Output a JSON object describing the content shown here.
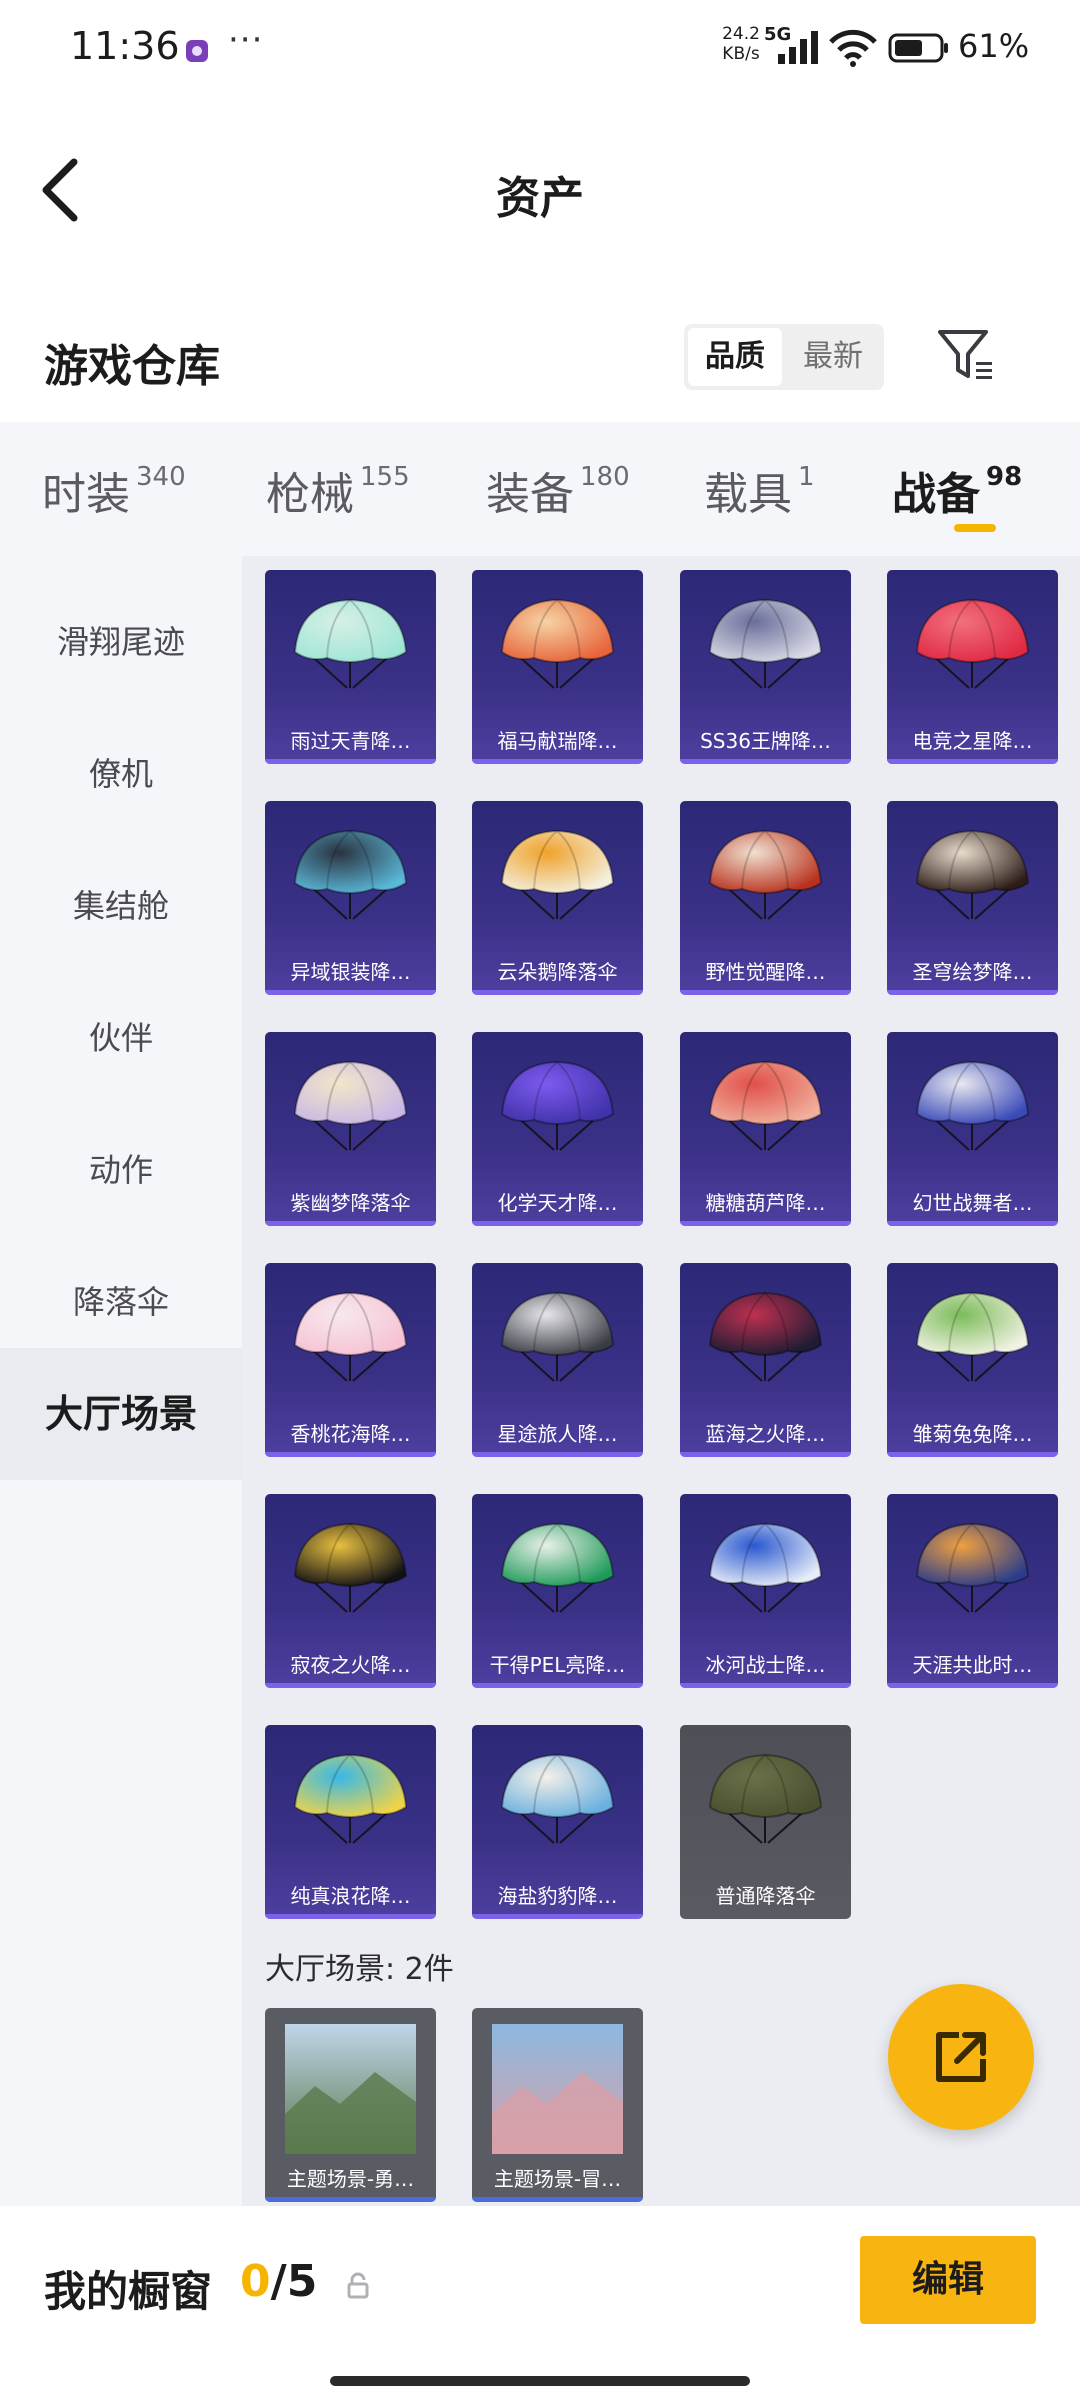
{
  "status_bar": {
    "time": "11:36",
    "network_speed_value": "24.2",
    "network_speed_unit": "KB/s",
    "network_type": "5G",
    "battery": "61%",
    "more": "···"
  },
  "header": {
    "title": "资产"
  },
  "section": {
    "title": "游戏仓库",
    "sort_options": [
      "品质",
      "最新"
    ]
  },
  "tabs": [
    {
      "label": "时装",
      "count": "340"
    },
    {
      "label": "枪械",
      "count": "155"
    },
    {
      "label": "装备",
      "count": "180"
    },
    {
      "label": "载具",
      "count": "1"
    },
    {
      "label": "战备",
      "count": "98"
    }
  ],
  "sidebar": {
    "items": [
      "滑翔尾迹",
      "僚机",
      "集结舱",
      "伙伴",
      "动作",
      "降落伞",
      "大厅场景"
    ],
    "active": "大厅场景"
  },
  "items": [
    {
      "label": "雨过天青降…",
      "c1": "#9fe6d6",
      "c2": "#d6efe6"
    },
    {
      "label": "福马献瑞降…",
      "c1": "#e8643a",
      "c2": "#f5d3a4"
    },
    {
      "label": "SS36王牌降…",
      "c1": "#d9d9e6",
      "c2": "#6a6f9a"
    },
    {
      "label": "电竞之星降…",
      "c1": "#e02a44",
      "c2": "#f2707c"
    },
    {
      "label": "异域银装降…",
      "c1": "#5ab8d8",
      "c2": "#2b3340"
    },
    {
      "label": "云朵鹅降落伞",
      "c1": "#f3f0e0",
      "c2": "#f0a22a"
    },
    {
      "label": "野性觉醒降…",
      "c1": "#b8321e",
      "c2": "#f0e0d0"
    },
    {
      "label": "圣穹绘梦降…",
      "c1": "#2d1c18",
      "c2": "#e8dccc"
    },
    {
      "label": "紫幽梦降落伞",
      "c1": "#c9b8e6",
      "c2": "#f2e6c8"
    },
    {
      "label": "化学天才降…",
      "c1": "#4032a8",
      "c2": "#7d5af0"
    },
    {
      "label": "糖糖葫芦降…",
      "c1": "#f0b09c",
      "c2": "#e0504a"
    },
    {
      "label": "幻世战舞者…",
      "c1": "#3a4ab8",
      "c2": "#e8e8f0"
    },
    {
      "label": "香桃花海降…",
      "c1": "#f6c2d4",
      "c2": "#f7e8ee"
    },
    {
      "label": "星途旅人降…",
      "c1": "#3a3c44",
      "c2": "#e6e6ea"
    },
    {
      "label": "蓝海之火降…",
      "c1": "#1c1c34",
      "c2": "#c03050"
    },
    {
      "label": "雏菊兔兔降…",
      "c1": "#f2f2e4",
      "c2": "#7cbc5a"
    },
    {
      "label": "寂夜之火降…",
      "c1": "#121216",
      "c2": "#e8c040"
    },
    {
      "label": "干得PEL亮降…",
      "c1": "#1f9a5a",
      "c2": "#e8f0e8"
    },
    {
      "label": "冰河战士降…",
      "c1": "#e8eef8",
      "c2": "#2a58d0"
    },
    {
      "label": "天涯共此时…",
      "c1": "#2a3c8a",
      "c2": "#f0a040"
    },
    {
      "label": "纯真浪花降…",
      "c1": "#f0d448",
      "c2": "#38b8e8"
    },
    {
      "label": "海盐豹豹降…",
      "c1": "#6ab0e0",
      "c2": "#f5f0e8"
    },
    {
      "label": "普通降落伞",
      "c1": "#4a5030",
      "c2": "#6a7048",
      "grey": true
    }
  ],
  "lobby_scenes": {
    "heading": "大厅场景: 2件",
    "items": [
      {
        "label": "主题场景-勇…",
        "sky": "#bfd6ea",
        "ground": "#5a7a4c"
      },
      {
        "label": "主题场景-冒…",
        "sky": "#8cb8e0",
        "ground": "#d8a0a8"
      }
    ]
  },
  "bottom_bar": {
    "title": "我的橱窗",
    "count_current": "0",
    "count_total": "/5",
    "edit_label": "编辑"
  },
  "colors": {
    "accent": "#f8b410",
    "card_purple": "#3a3187",
    "card_bar": "#7c62e8"
  },
  "icons": [
    "back-arrow-icon",
    "filter-icon",
    "lock-icon",
    "share-icon",
    "signal-icon",
    "wifi-icon",
    "battery-icon"
  ]
}
